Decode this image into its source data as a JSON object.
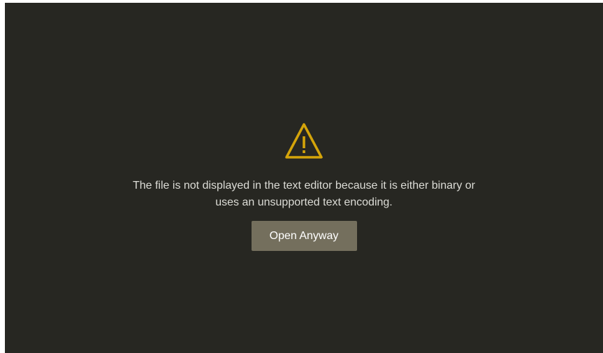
{
  "colors": {
    "background": "#272722",
    "warning": "#d4a40a",
    "button": "#746f5d",
    "text": "#dcdcd6"
  },
  "icon": "warning-icon",
  "message": {
    "line1": "The file is not displayed in the text editor because it is either binary or",
    "line2": "uses an unsupported text encoding."
  },
  "button": {
    "label": "Open Anyway"
  }
}
